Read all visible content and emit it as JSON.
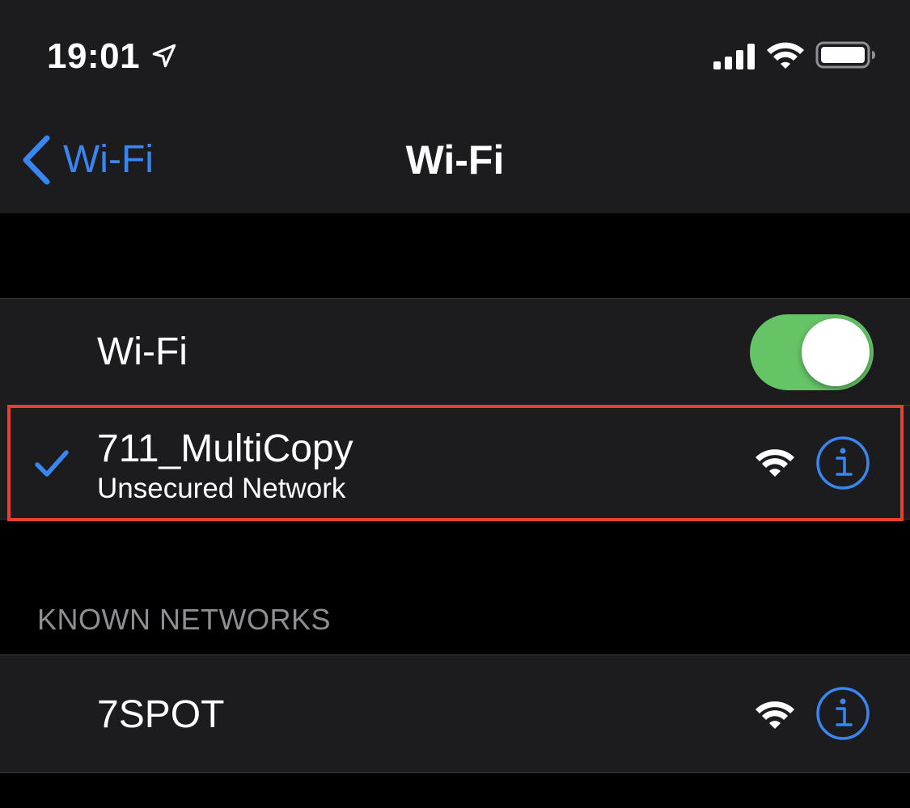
{
  "status_bar": {
    "time": "19:01",
    "icons": [
      "location-icon",
      "cellular-signal-icon",
      "wifi-icon",
      "battery-icon"
    ]
  },
  "nav": {
    "back_label": "Wi-Fi",
    "title": "Wi-Fi"
  },
  "wifi_toggle": {
    "label": "Wi-Fi",
    "on": true
  },
  "connected_network": {
    "name": "711_MultiCopy",
    "subtitle": "Unsecured Network",
    "connected": true
  },
  "known_networks": {
    "header": "KNOWN NETWORKS",
    "items": [
      {
        "name": "7SPOT"
      }
    ]
  },
  "colors": {
    "accent": "#3a86f0",
    "toggle_on": "#65c466",
    "highlight": "#e8402e",
    "background": "#000000",
    "cell_background": "#1c1c1e",
    "secondary_text": "#8e8e93"
  }
}
